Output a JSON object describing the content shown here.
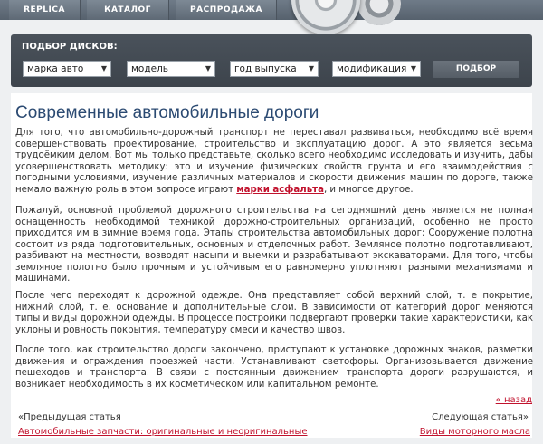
{
  "nav": {
    "items": [
      {
        "label": "REPLICA"
      },
      {
        "label": "КАТАЛОГ"
      },
      {
        "label": "РАСПРОДАЖА"
      }
    ]
  },
  "selector": {
    "title": "ПОДБОР ДИСКОВ:",
    "fields": [
      {
        "value": "марка авто"
      },
      {
        "value": "модель"
      },
      {
        "value": "год выпуска"
      },
      {
        "value": "модификация"
      }
    ],
    "button_label": "ПОДБОР"
  },
  "article": {
    "title": "Современные автомобильные дороги",
    "p1_text": "Для того, что автомобильно-дорожный транспорт не переставал развиваться, необходимо всё время совершенствовать проектирование, строительство и эксплуатацию дорог. А это является весьма трудоёмким делом. Вот мы только представьте, сколько всего необходимо исследовать и изучить, дабы усовершенствовать методику: это и изучение физических свойств грунта и его взаимодействия с погодными условиями, изучение различных материалов и скорости движения машин по дороге, также немало важную роль в этом вопросе играют ",
    "p1_link": "марки асфальта",
    "p1_tail": ", и многое другое.",
    "p2": "Пожалуй, основной проблемой дорожного строительства на сегодняшний день является не полная оснащенность необходимой техникой дорожно-строительных организаций, особенно не просто приходится им в зимние время года. Этапы строительства автомобильных дорог: Сооружение полотна состоит из ряда подготовительных, основных и отделочных работ. Земляное полотно подготавливают, разбивают на местности, возводят насыпи и выемки и разрабатывают экскаваторами. Для того, чтобы земляное полотно было прочным и устойчивым его равномерно уплотняют разными механизмами и машинами.",
    "p3": "После чего переходят к дорожной одежде. Она представляет собой верхний слой, т. е покрытие, нижний слой, т. е. основание и дополнительные слои. В зависимости от категорий дорог меняются типы и виды дорожной одежды. В процессе постройки подвергают проверки такие характеристики, как уклоны и ровность покрытия, температуру смеси и качество швов.",
    "p4": "После того, как строительство дороги закончено, приступают к установке дорожных знаков, разметки движения и ограждения проезжей части. Устанавливают светофоры. Организовывается движение пешеходов и транспорта. В связи с постоянным движением транспорта дороги разрушаются, и возникает необходимость в их косметическом или капитальном ремонте.",
    "back_link": "« назад",
    "prev_label": "«Предыдущая статья",
    "next_label": "Следующая статья»",
    "prev_link": "Автомобильные запчасти: оригинальные и неоригинальные",
    "next_link": "Виды моторного масла"
  }
}
